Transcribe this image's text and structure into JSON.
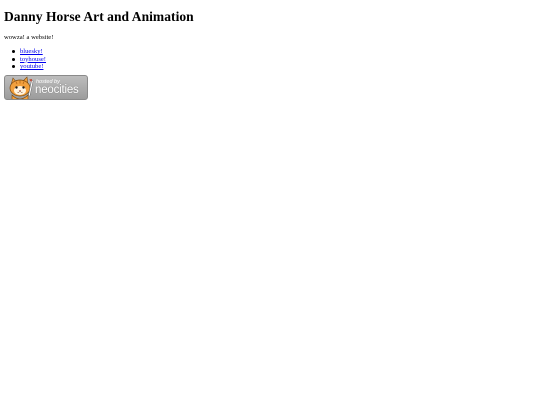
{
  "page": {
    "title": "Danny Horse Art and Animation",
    "tagline": "wowza! a website!"
  },
  "links": [
    {
      "label": "bluesky!"
    },
    {
      "label": "toyhouse!"
    },
    {
      "label": "youtube!"
    }
  ],
  "badge": {
    "hosted_text": "hosted by",
    "brand_text": "neocities",
    "icon": "neocities-cat-icon"
  },
  "colors": {
    "link": "#0000ee",
    "text": "#000000",
    "background": "#ffffff",
    "badge_bg": "#a9a9a9",
    "cat_orange": "#f2a03d"
  }
}
